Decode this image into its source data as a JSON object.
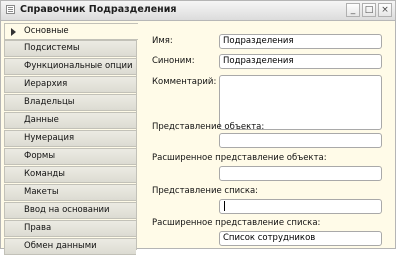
{
  "window": {
    "title": "Справочник Подразделения",
    "buttons": [
      "_",
      "□",
      "×"
    ]
  },
  "sidebar": {
    "items": [
      {
        "label": "Основные",
        "active": true
      },
      {
        "label": "Подсистемы"
      },
      {
        "label": "Функциональные опции"
      },
      {
        "label": "Иерархия"
      },
      {
        "label": "Владельцы"
      },
      {
        "label": "Данные"
      },
      {
        "label": "Нумерация"
      },
      {
        "label": "Формы"
      },
      {
        "label": "Команды"
      },
      {
        "label": "Макеты"
      },
      {
        "label": "Ввод на основании"
      },
      {
        "label": "Права"
      },
      {
        "label": "Обмен данными"
      }
    ]
  },
  "form": {
    "name_label": "Имя:",
    "name_value": "Подразделения",
    "synonym_label": "Синоним:",
    "synonym_value": "Подразделения",
    "comment_label": "Комментарий:",
    "comment_value": "",
    "object_repr_label": "Представление объекта:",
    "object_repr_value": "",
    "ext_object_repr_label": "Расширенное представление объекта:",
    "ext_object_repr_value": "",
    "list_repr_label": "Представление списка:",
    "list_repr_value": "",
    "ext_list_repr_label": "Расширенное представление списка:",
    "ext_list_repr_value": "Список сотрудников"
  }
}
